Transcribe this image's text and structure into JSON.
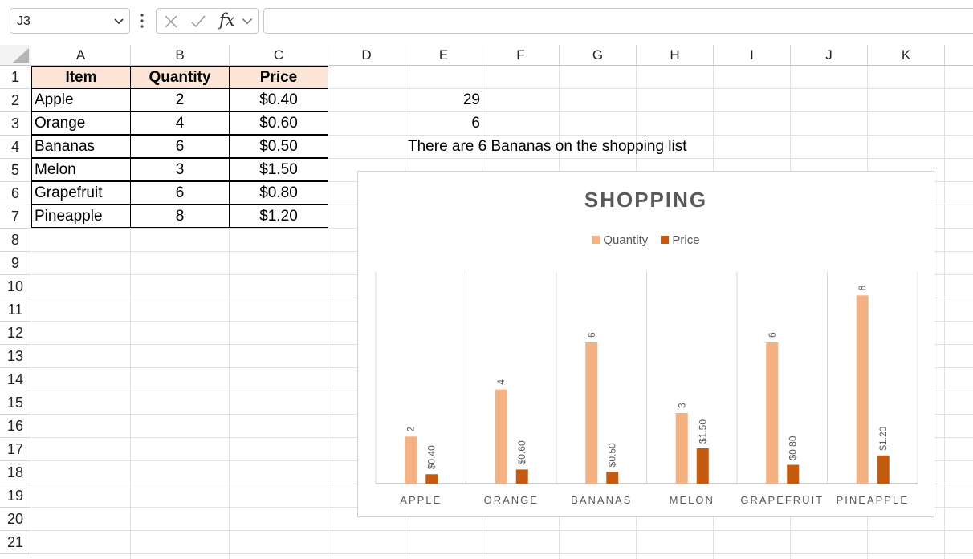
{
  "formula_bar": {
    "name_box": "J3",
    "fx_label": "fx",
    "formula": ""
  },
  "columns": [
    "A",
    "B",
    "C",
    "D",
    "E",
    "F",
    "G",
    "H",
    "I",
    "J",
    "K"
  ],
  "rows": [
    "1",
    "2",
    "3",
    "4",
    "5",
    "6",
    "7",
    "8",
    "9",
    "10",
    "11",
    "12",
    "13",
    "14",
    "15",
    "16",
    "17",
    "18",
    "19",
    "20",
    "21"
  ],
  "table": {
    "headers": [
      "Item",
      "Quantity",
      "Price"
    ],
    "rows": [
      [
        "Apple",
        "2",
        "$0.40"
      ],
      [
        "Orange",
        "4",
        "$0.60"
      ],
      [
        "Bananas",
        "6",
        "$0.50"
      ],
      [
        "Melon",
        "3",
        "$1.50"
      ],
      [
        "Grapefruit",
        "6",
        "$0.80"
      ],
      [
        "Pineapple",
        "8",
        "$1.20"
      ]
    ]
  },
  "side_cells": {
    "e2": "29",
    "e3": "6",
    "e4": "There are 6 Bananas on the shopping list"
  },
  "colors": {
    "table_header_fill": "#fce4d6",
    "quantity_series": "#f4b183",
    "price_series": "#c55a11"
  },
  "chart_data": {
    "type": "bar",
    "title": "SHOPPING",
    "categories": [
      "APPLE",
      "ORANGE",
      "BANANAS",
      "MELON",
      "GRAPEFRUIT",
      "PINEAPPLE"
    ],
    "series": [
      {
        "name": "Quantity",
        "values": [
          2,
          4,
          6,
          3,
          6,
          8
        ],
        "labels": [
          "2",
          "4",
          "6",
          "3",
          "6",
          "8"
        ],
        "color": "#f4b183"
      },
      {
        "name": "Price",
        "values": [
          0.4,
          0.6,
          0.5,
          1.5,
          0.8,
          1.2
        ],
        "labels": [
          "$0.40",
          "$0.60",
          "$0.50",
          "$1.50",
          "$0.80",
          "$1.20"
        ],
        "color": "#c55a11"
      }
    ],
    "ylim": [
      0,
      9
    ],
    "grid": false,
    "legend": "top"
  }
}
